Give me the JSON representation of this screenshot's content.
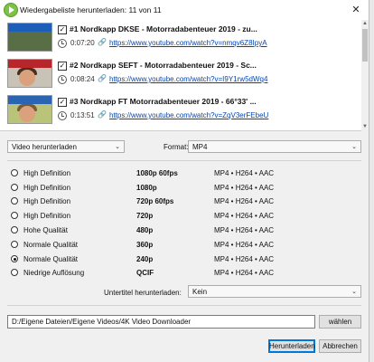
{
  "window": {
    "title": "Wiedergabeliste herunterladen: 11 von 11",
    "close_glyph": "✕"
  },
  "videos": [
    {
      "checked": true,
      "title": "#1 Nordkapp DKSE - Motorradabenteuer 2019 - zu...",
      "duration": "0:07:20",
      "url": "https://www.youtube.com/watch?v=nmqv6Z8IpyA"
    },
    {
      "checked": true,
      "title": "#2 Nordkapp SEFT - Motorradabenteuer 2019 - Sc...",
      "duration": "0:08:24",
      "url": "https://www.youtube.com/watch?v=I9Y1rw5dWq4"
    },
    {
      "checked": true,
      "title": "#3 Nordkapp FT Motorradabenteuer 2019 - 66°33' ...",
      "duration": "0:13:51",
      "url": "https://www.youtube.com/watch?v=ZqV3erFEbeU"
    }
  ],
  "download_type": {
    "value": "Video herunterladen"
  },
  "format": {
    "label": "Format:",
    "value": "MP4"
  },
  "qualities": [
    {
      "label": "High Definition",
      "resolution": "1080p 60fps",
      "format": "MP4 • H264 • AAC",
      "selected": false
    },
    {
      "label": "High Definition",
      "resolution": "1080p",
      "format": "MP4 • H264 • AAC",
      "selected": false
    },
    {
      "label": "High Definition",
      "resolution": "720p 60fps",
      "format": "MP4 • H264 • AAC",
      "selected": false
    },
    {
      "label": "High Definition",
      "resolution": "720p",
      "format": "MP4 • H264 • AAC",
      "selected": false
    },
    {
      "label": "Hohe Qualität",
      "resolution": "480p",
      "format": "MP4 • H264 • AAC",
      "selected": false
    },
    {
      "label": "Normale Qualität",
      "resolution": "360p",
      "format": "MP4 • H264 • AAC",
      "selected": false
    },
    {
      "label": "Normale Qualität",
      "resolution": "240p",
      "format": "MP4 • H264 • AAC",
      "selected": true
    },
    {
      "label": "Niedrige Auflösung",
      "resolution": "QCIF",
      "format": "MP4 • H264 • AAC",
      "selected": false
    }
  ],
  "subtitles": {
    "label": "Untertitel herunterladen:",
    "value": "Kein"
  },
  "save_path": {
    "value": "D:/Eigene Dateien/Eigene Videos/4K Video Downloader",
    "choose_label": "wählen"
  },
  "actions": {
    "download_label": "Herunterladen",
    "cancel_label": "Abbrechen"
  },
  "icons": {
    "checkbox": "check-icon",
    "duration": "clock-icon",
    "link": "link-icon",
    "dropdown": "chevron-down-icon"
  },
  "colors": {
    "link": "#0645ad",
    "accent": "#0078d7",
    "app_icon": "#7cc243"
  }
}
